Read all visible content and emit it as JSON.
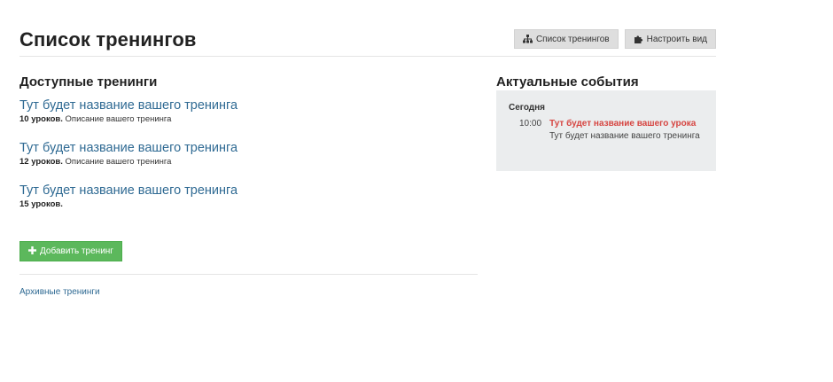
{
  "header": {
    "title": "Список тренингов",
    "buttons": {
      "list_label": "Список тренингов",
      "customize_label": "Настроить вид"
    }
  },
  "available": {
    "title": "Доступные тренинги",
    "items": [
      {
        "title": "Тут будет название вашего тренинга",
        "lessons": "10 уроков.",
        "description": "Описание вашего тренинга"
      },
      {
        "title": "Тут будет название вашего тренинга",
        "lessons": "12 уроков.",
        "description": "Описание вашего тренинга"
      },
      {
        "title": "Тут будет название вашего тренинга",
        "lessons": "15 уроков.",
        "description": ""
      }
    ],
    "add_button_label": "Добавить тренинг",
    "archive_link": "Архивные тренинги"
  },
  "events": {
    "title": "Актуальные события",
    "day": "Сегодня",
    "items": [
      {
        "time": "10:00",
        "lesson": "Тут будет название вашего урока",
        "training": "Тут будет название вашего тренинга"
      }
    ]
  },
  "icons": {
    "list": "sitemap-icon",
    "customize": "puzzle-icon",
    "add": "plus-icon"
  },
  "colors": {
    "link": "#2f6a93",
    "add_button": "#5cb85c",
    "event_lesson": "#d64541",
    "events_bg": "#ebedee"
  }
}
